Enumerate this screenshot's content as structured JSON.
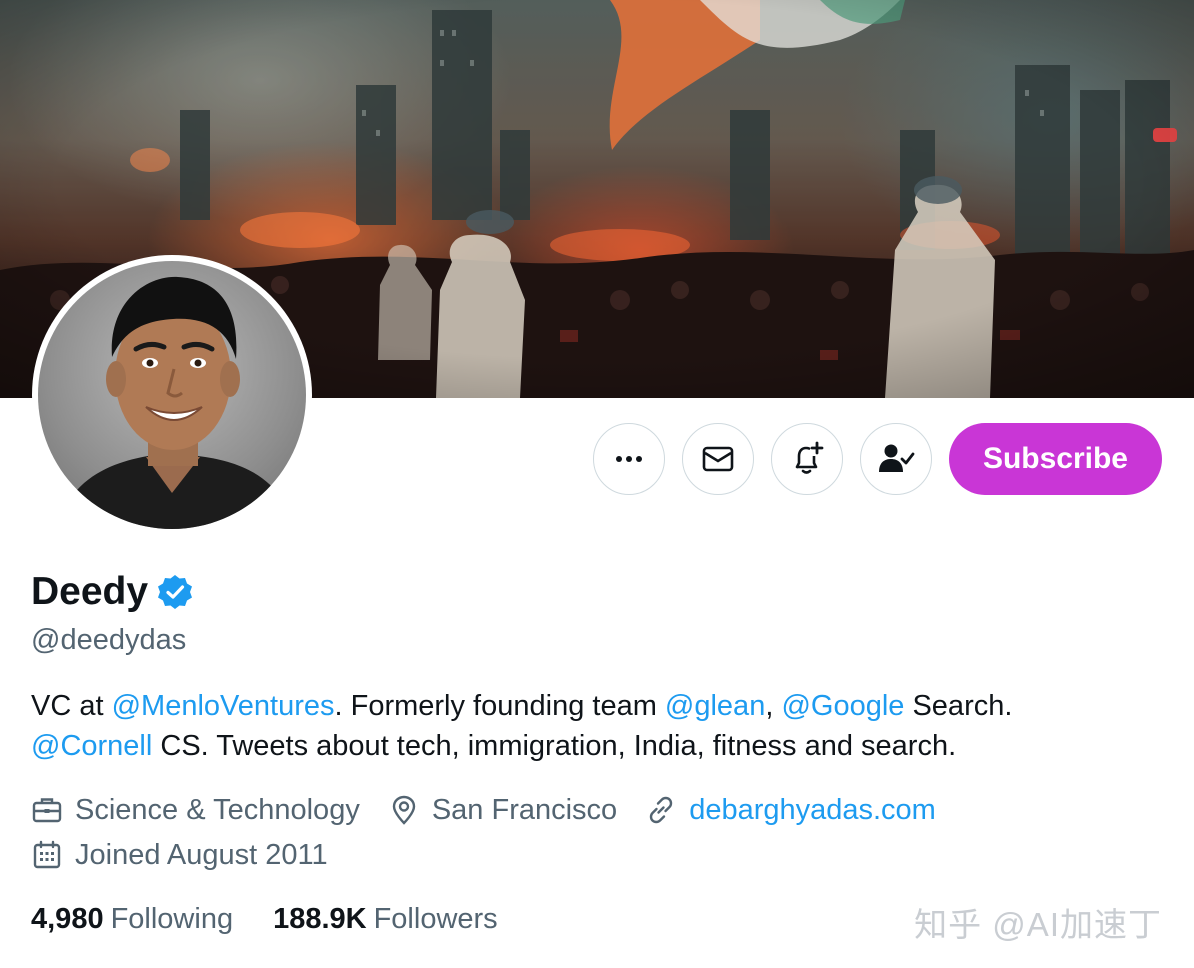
{
  "header": {
    "banner_icon": "battle-scene-banner",
    "avatar_icon": "profile-photo"
  },
  "actions": {
    "more_icon": "more-dots-icon",
    "message_icon": "envelope-icon",
    "notify_icon": "bell-plus-icon",
    "following_icon": "person-check-icon",
    "subscribe_label": "Subscribe",
    "subscribe_color": "#c936d6"
  },
  "profile": {
    "display_name": "Deedy",
    "verified_icon": "verified-badge-icon",
    "handle": "@deedydas",
    "bio": {
      "line1": [
        {
          "text": "VC at ",
          "mention": false
        },
        {
          "text": "@MenloVentures",
          "mention": true
        },
        {
          "text": ". Formerly founding team ",
          "mention": false
        },
        {
          "text": "@glean",
          "mention": true
        },
        {
          "text": ", ",
          "mention": false
        },
        {
          "text": "@Google",
          "mention": true
        },
        {
          "text": " Search.",
          "mention": false
        }
      ],
      "line2": [
        {
          "text": "@Cornell",
          "mention": true
        },
        {
          "text": " CS. Tweets about tech, immigration, India, fitness and search.",
          "mention": false
        }
      ]
    },
    "category": "Science & Technology",
    "location": "San Francisco",
    "website": "debarghyadas.com",
    "joined": "Joined August 2011",
    "link_color": "#1d9bf0"
  },
  "stats": {
    "following_count": "4,980",
    "following_label": "Following",
    "followers_count": "188.9K",
    "followers_label": "Followers"
  },
  "watermark": "知乎 @AI加速丁"
}
